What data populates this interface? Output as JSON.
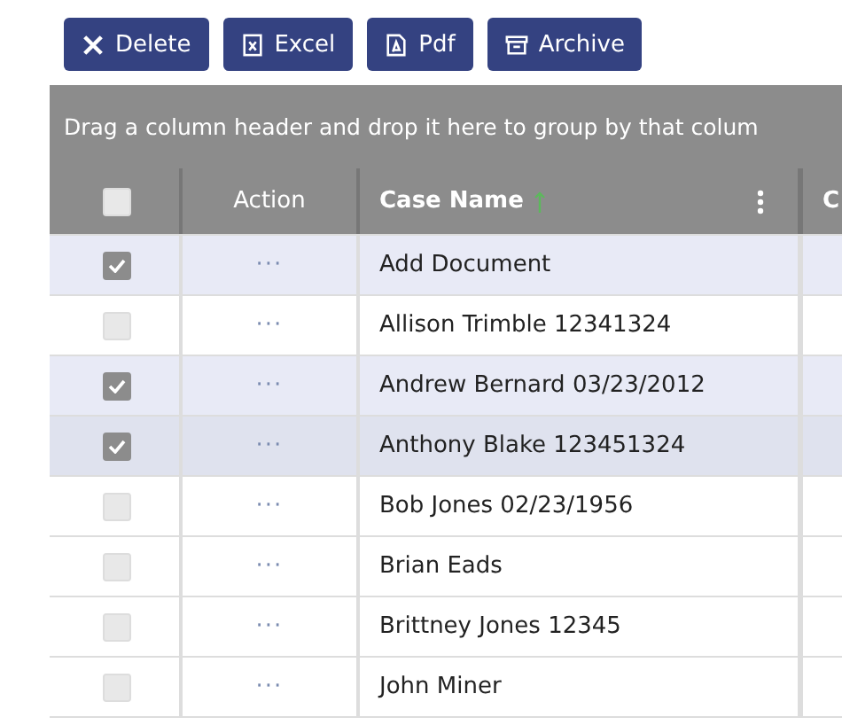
{
  "toolbar": [
    {
      "label": "Delete",
      "kind": "delete"
    },
    {
      "label": "Excel",
      "kind": "excel"
    },
    {
      "label": "Pdf",
      "kind": "pdf"
    },
    {
      "label": "Archive",
      "kind": "archive"
    }
  ],
  "group_panel": {
    "hint": "Drag a column header and drop it here to group by that colum"
  },
  "table": {
    "header_checked": false,
    "columns": [
      {
        "label": "Action",
        "kind": "action"
      },
      {
        "label": "Case Name",
        "kind": "name",
        "sorted": true
      },
      {
        "label": "C",
        "kind": "partial"
      }
    ],
    "rows": [
      {
        "checked": true,
        "selected": true,
        "hovered": false,
        "action": "···",
        "case_name": "Add Document"
      },
      {
        "checked": false,
        "selected": false,
        "hovered": false,
        "action": "···",
        "case_name": "Allison Trimble 12341324"
      },
      {
        "checked": true,
        "selected": true,
        "hovered": false,
        "action": "···",
        "case_name": "Andrew Bernard 03/23/2012"
      },
      {
        "checked": true,
        "selected": true,
        "hovered": true,
        "action": "···",
        "case_name": "Anthony Blake 123451324"
      },
      {
        "checked": false,
        "selected": false,
        "hovered": false,
        "action": "···",
        "case_name": "Bob Jones 02/23/1956"
      },
      {
        "checked": false,
        "selected": false,
        "hovered": false,
        "action": "···",
        "case_name": "Brian Eads"
      },
      {
        "checked": false,
        "selected": false,
        "hovered": false,
        "action": "···",
        "case_name": "Brittney Jones 12345"
      },
      {
        "checked": false,
        "selected": false,
        "hovered": false,
        "action": "···",
        "case_name": "John Miner"
      }
    ]
  }
}
